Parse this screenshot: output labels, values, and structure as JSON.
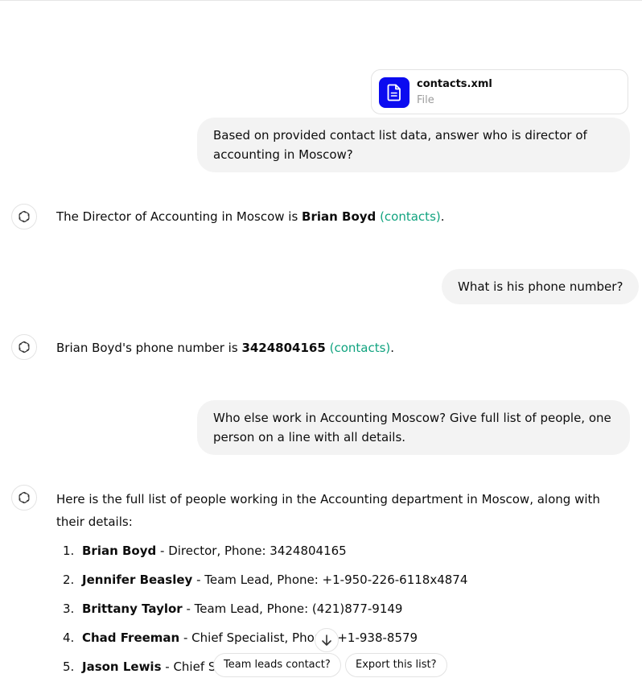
{
  "attachment": {
    "name": "contacts.xml",
    "type": "File"
  },
  "messages": [
    {
      "role": "user",
      "text": "Based on provided contact list data, answer who is director of accounting in Moscow?"
    },
    {
      "role": "assistant",
      "prefix": "The Director of Accounting in Moscow is ",
      "bold": "Brian Boyd",
      "citation": "(contacts)",
      "suffix": "."
    },
    {
      "role": "user",
      "text": "What is his phone number?"
    },
    {
      "role": "assistant",
      "prefix": "Brian Boyd's phone number is ",
      "bold": "3424804165",
      "citation": "(contacts)",
      "suffix": "."
    },
    {
      "role": "user",
      "text": "Who else work in Accounting Moscow? Give full list of people, one person on a line with all details."
    },
    {
      "role": "assistant",
      "intro": "Here is the full list of people working in the Accounting department in Moscow, along with their details:",
      "list": [
        {
          "num": "1.",
          "name": "Brian Boyd",
          "details": " - Director, Phone: 3424804165"
        },
        {
          "num": "2.",
          "name": "Jennifer Beasley",
          "details": " - Team Lead, Phone: +1-950-226-6118x4874"
        },
        {
          "num": "3.",
          "name": "Brittany Taylor",
          "details": " - Team Lead, Phone: (421)877-9149"
        },
        {
          "num": "4.",
          "name": "Chad Freeman",
          "details": " - Chief Specialist, Phone: +1-938-8579"
        },
        {
          "num": "5.",
          "name": "Jason Lewis",
          "details": " - Chief Sp"
        }
      ]
    }
  ],
  "suggestions": [
    "Team leads contact?",
    "Export this list?"
  ],
  "icons": {
    "assistant": "openai-logo-icon",
    "file": "file-icon",
    "scroll": "arrow-down-icon"
  },
  "colors": {
    "citation": "#10a37f",
    "file_icon_bg": "#0b0bf0",
    "user_bubble": "#f3f3f3"
  }
}
